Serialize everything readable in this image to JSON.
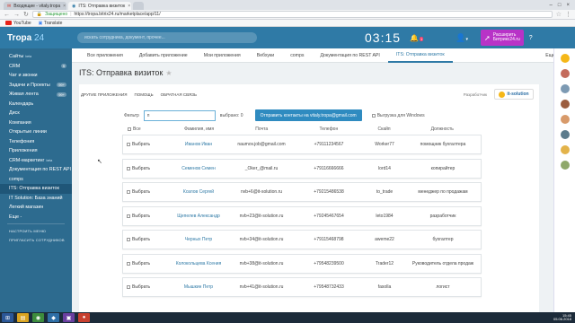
{
  "browser": {
    "tabs": [
      {
        "title": "Входящие - vitaly.tropa",
        "active": false
      },
      {
        "title": "ITS: Отправка визиток",
        "active": true
      },
      {
        "title": "",
        "active": false
      }
    ],
    "url": {
      "secure_label": "Защищено",
      "path": "https://tropa.bitrix24.ru/marketplace/app/11/"
    },
    "bookmarks": [
      "YouTube",
      "Translate"
    ]
  },
  "topbar": {
    "logo_main": "Tropa",
    "logo_num": "24",
    "search_placeholder": "искать сотрудника, документ, прочее...",
    "clock": "03:15",
    "notifications": "1",
    "extend_line1": "Расширить",
    "extend_line2": "Битрикс24.ru",
    "help": "?"
  },
  "sidebar": {
    "items": [
      {
        "label": "Сайты",
        "beta": "beta",
        "count": ""
      },
      {
        "label": "CRM",
        "beta": "",
        "count": "9"
      },
      {
        "label": "Чат и звонки",
        "beta": "",
        "count": ""
      },
      {
        "label": "Задачи и Проекты",
        "beta": "",
        "count": "99+"
      },
      {
        "label": "Живая лента",
        "beta": "",
        "count": "99+"
      },
      {
        "label": "Календарь",
        "beta": "",
        "count": ""
      },
      {
        "label": "Диск",
        "beta": "",
        "count": ""
      },
      {
        "label": "Компания",
        "beta": "",
        "count": ""
      },
      {
        "label": "Открытые линии",
        "beta": "",
        "count": ""
      },
      {
        "label": "Телефония",
        "beta": "",
        "count": ""
      },
      {
        "label": "Приложения",
        "beta": "",
        "count": ""
      },
      {
        "label": "CRM-маркетинг",
        "beta": "beta",
        "count": ""
      },
      {
        "label": "Документация по REST API",
        "beta": "",
        "count": ""
      },
      {
        "label": "comps",
        "beta": "",
        "count": ""
      },
      {
        "label": "ITS: Отправка визиток",
        "beta": "",
        "count": "",
        "active": true
      },
      {
        "label": "IT Solution: База знаний",
        "beta": "",
        "count": ""
      },
      {
        "label": "Легкий магазин",
        "beta": "",
        "count": ""
      },
      {
        "label": "Еще -",
        "beta": "",
        "count": ""
      }
    ],
    "settings_label": "НАСТРОИТЬ МЕНЮ",
    "invite_label": "ПРИГЛАСИТЬ СОТРУДНИКОВ"
  },
  "toptabs": [
    "Все приложения",
    "Добавить приложение",
    "Мои приложения",
    "Вебхуки",
    "comps",
    "Документация по REST API",
    "ITS: Отправка визиток",
    "Еще -"
  ],
  "page_title": "ITS: Отправка визиток",
  "app": {
    "links": [
      "ДРУГИЕ ПРИЛОЖЕНИЯ",
      "ПОМОЩЬ",
      "ОБРАТНАЯ СВЯЗЬ"
    ],
    "dev_label": "Разработчик",
    "dev_logo": "it-solution",
    "filter_label": "Фильтр",
    "filter_value": "п",
    "selected_label": "выбрано: 0",
    "send_button": "Отправить контакты на vitaly.tropa@gmail.com",
    "win_label": "Выгрузка для Windows",
    "headers": [
      "Все",
      "Фамилия, имя",
      "Почта",
      "Телефон",
      "Скайп",
      "Должность"
    ],
    "select_label": "Выбрать",
    "rows": [
      {
        "name": "Иванов Иван",
        "email": "naumov.job@gmail.com",
        "phone": "+79111234567",
        "skype": "Worker77",
        "position": "помощник бухгалтера"
      },
      {
        "name": "Семенов Семен",
        "email": "_Oker_@mail.ru",
        "phone": "+79116666666",
        "skype": "lord14",
        "position": "копирайтер"
      },
      {
        "name": "Козлов Сергей",
        "email": "nvb+6@it-solution.ru",
        "phone": "+79215486538",
        "skype": "to_trade",
        "position": "менеджер по продажам"
      },
      {
        "name": "Щепелев Александр",
        "email": "nvb+23@it-solution.ru",
        "phone": "+79245467654",
        "skype": "leto1984",
        "position": "разработчик"
      },
      {
        "name": "Черных Петр",
        "email": "nvb+34@it-solution.ru",
        "phone": "+79115468798",
        "skype": "aweme22",
        "position": "бухгалтер"
      },
      {
        "name": "Колокольцева Ксения",
        "email": "nvb+38@it-solution.ru",
        "phone": "+79548239500",
        "skype": "Trader12",
        "position": "Руководитель отдела продаж"
      },
      {
        "name": "Мышкин Петр",
        "email": "nvb+41@it-solution.ru",
        "phone": "+79548732433",
        "skype": "fasolla",
        "position": "логист"
      }
    ]
  },
  "taskbar": {
    "time": "15:45",
    "date": "05.06.2018"
  },
  "colors": {
    "accent": "#2f7aa6",
    "sidebar": "#2d6b8f",
    "extend": "#b833c7",
    "button": "#2f8bc0"
  }
}
